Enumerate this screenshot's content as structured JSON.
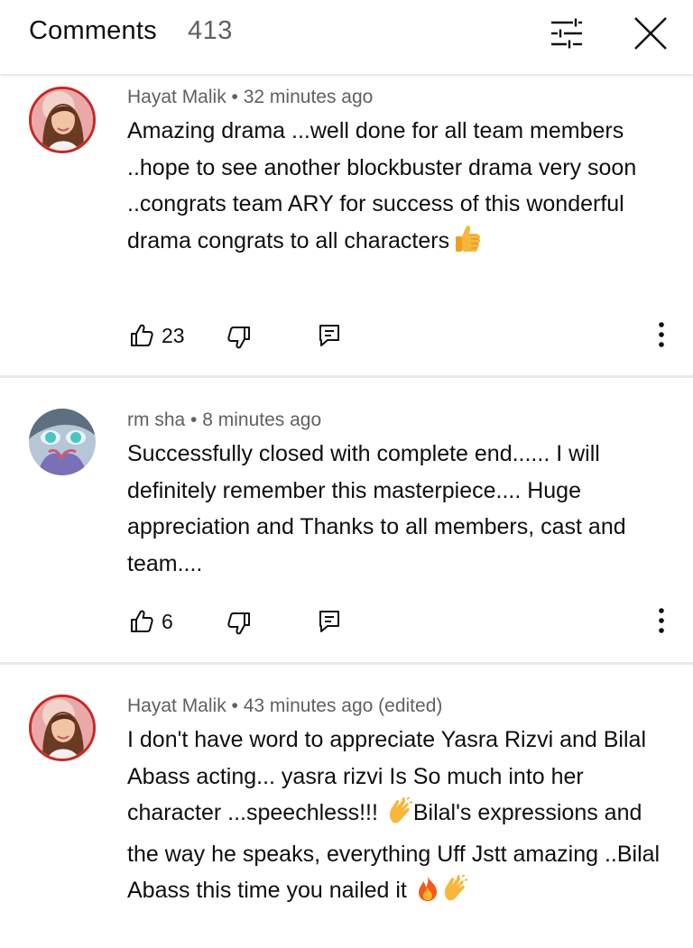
{
  "header": {
    "title": "Comments",
    "count": "413",
    "filter_icon": "tune-icon",
    "close_icon": "close-icon"
  },
  "comments": [
    {
      "author": "Hayat Malik",
      "separator": " • ",
      "time": "32 minutes ago",
      "text": "Amazing drama ...well done for all team members ..hope to see another blockbuster drama very soon ..congrats team ARY for success of this wonderful drama congrats to all characters",
      "emojis": [
        "thumbs-up"
      ],
      "likes": "23"
    },
    {
      "author": "rm sha",
      "separator": " • ",
      "time": "8 minutes ago",
      "text": "Successfully closed with complete end...... I will definitely remember this masterpiece.... Huge appreciation and Thanks to all members, cast and team....",
      "likes": "6"
    },
    {
      "author": "Hayat Malik",
      "separator": " • ",
      "time": "43 minutes ago (edited)",
      "text_part1": "I don't have word to appreciate Yasra Rizvi and Bilal Abass acting... yasra rizvi Is So much into her character ...speechless!!!",
      "text_part2": "Bilal's expressions and the way he speaks, everything Uff Jstt amazing ..Bilal Abass this time you nailed it",
      "emojis": [
        "clapping-hands",
        "fire",
        "clapping-hands"
      ]
    }
  ],
  "colors": {
    "text_primary": "#0f0f0f",
    "text_secondary": "#606060",
    "avatar_ring": "#c62828",
    "divider": "#e8e8e8"
  }
}
